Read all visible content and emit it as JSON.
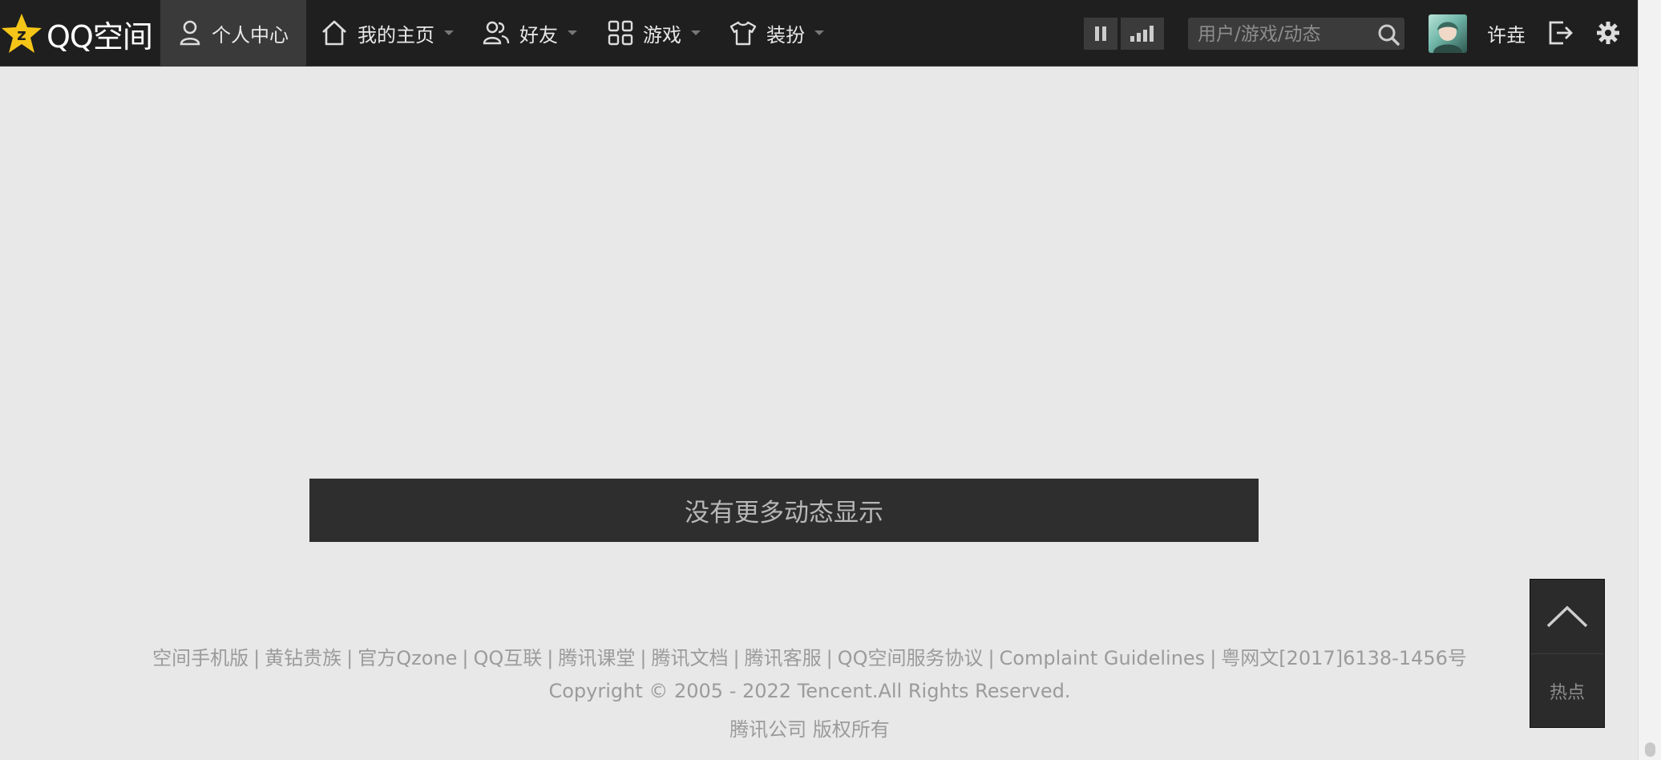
{
  "brand": {
    "logo_text": "QQ空间"
  },
  "nav": {
    "items": [
      {
        "label": "个人中心",
        "icon": "user-icon"
      },
      {
        "label": "我的主页",
        "icon": "home-icon"
      },
      {
        "label": "好友",
        "icon": "friends-icon"
      },
      {
        "label": "游戏",
        "icon": "grid-icon"
      },
      {
        "label": "装扮",
        "icon": "shirt-icon"
      }
    ]
  },
  "search": {
    "placeholder": "用户/游戏/动态"
  },
  "user": {
    "name": "许垚"
  },
  "feed": {
    "no_more_text": "没有更多动态显示"
  },
  "footer": {
    "links": [
      "空间手机版",
      "黄钻贵族",
      "官方Qzone",
      "QQ互联",
      "腾讯课堂",
      "腾讯文档",
      "腾讯客服",
      "QQ空间服务协议",
      "Complaint Guidelines",
      "粤网文[2017]6138-1456号"
    ],
    "copyright": "Copyright © 2005 - 2022 Tencent.All Rights Reserved.",
    "company": "腾讯公司 版权所有"
  },
  "side_widget": {
    "hot_label": "热点"
  },
  "colors": {
    "topbar": "#1f1f1f",
    "page_bg": "#e8e8e8",
    "logo_star": "#f5c518"
  }
}
